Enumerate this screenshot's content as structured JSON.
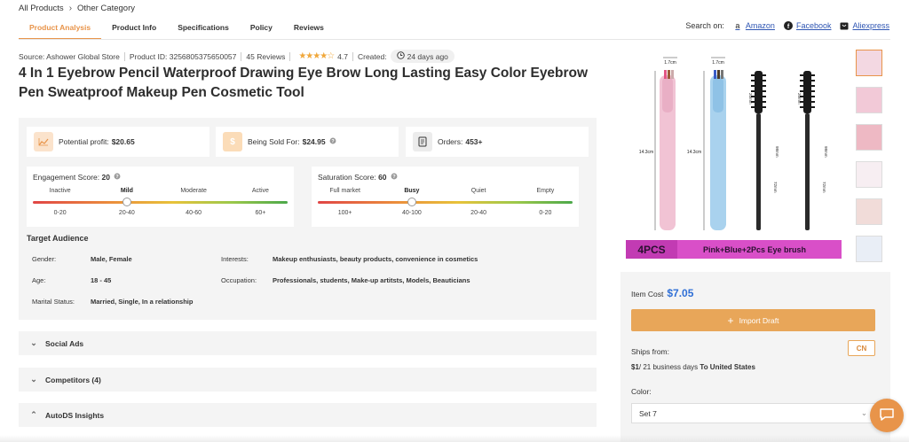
{
  "breadcrumb": {
    "items": [
      "All Products",
      "Other Category"
    ]
  },
  "tabs": [
    {
      "label": "Product Analysis",
      "active": true
    },
    {
      "label": "Product Info"
    },
    {
      "label": "Specifications"
    },
    {
      "label": "Policy"
    },
    {
      "label": "Reviews"
    }
  ],
  "search_on": {
    "label": "Search on:",
    "links": [
      {
        "label": "Amazon",
        "icon": "amazon-icon"
      },
      {
        "label": "Facebook",
        "icon": "facebook-icon"
      },
      {
        "label": "Aliexpress",
        "icon": "aliexpress-icon"
      }
    ]
  },
  "meta": {
    "source": "Source: Ashower Global Store",
    "product_id": "Product ID: 3256805375650057",
    "reviews": "45 Reviews",
    "stars": "★★★★☆",
    "rating": "4.7",
    "created_label": "Created:",
    "created_ago": "24 days ago"
  },
  "product": {
    "title": "4 In 1 Eyebrow Pencil Waterproof Drawing Eye Brow Long Lasting Easy Color Eyebrow Pen Sweatproof Makeup Pen Cosmetic Tool"
  },
  "stats": [
    {
      "label": "Potential profit:",
      "value": "$20.65",
      "icon": "chart-icon"
    },
    {
      "label": "Being Sold For:",
      "value": "$24.95",
      "icon": "dollar-icon"
    },
    {
      "label": "Orders:",
      "value": "453+",
      "icon": "orders-icon"
    }
  ],
  "engagement": {
    "label": "Engagement Score:",
    "value": "20",
    "level": 0.37,
    "levels": [
      "Inactive",
      "Mild",
      "Moderate",
      "Active"
    ],
    "ranges": [
      "0-20",
      "20-40",
      "40-60",
      "60+"
    ],
    "active_index": 1
  },
  "saturation": {
    "label": "Saturation Score:",
    "value": "60",
    "level": 0.37,
    "levels": [
      "Full market",
      "Busy",
      "Quiet",
      "Empty"
    ],
    "ranges": [
      "100+",
      "40-100",
      "20-40",
      "0-20"
    ],
    "active_index": 1
  },
  "target_audience": {
    "title": "Target Audience",
    "gender_label": "Gender:",
    "gender": "Male, Female",
    "age_label": "Age:",
    "age": "18 - 45",
    "marital_label": "Marital Status:",
    "marital": "Married, Single, In a relationship",
    "interests_label": "Interests:",
    "interests": "Makeup enthusiasts, beauty products, convenience in cosmetics",
    "occupation_label": "Occupation:",
    "occupation": "Professionals, students, Make-up artitsts, Models, Beauticians"
  },
  "accordions": [
    {
      "label": "Social Ads",
      "expanded": false
    },
    {
      "label": "Competitors (4)",
      "expanded": false
    },
    {
      "label": "AutoDS Insights",
      "expanded": true
    }
  ],
  "image_labels": {
    "dim1": "1.7cm",
    "dim2": "1.7cm",
    "len1": "14.3cm",
    "len2": "14.3cm",
    "brush1": "20mm",
    "brush1b": "98mm",
    "brush1c": "72mm",
    "brush2": "20mm",
    "brush2b": "98mm",
    "brush2c": "72mm",
    "banner_left": "4PCS",
    "banner_right": "Pink+Blue+2Pcs Eye brush"
  },
  "purchase": {
    "item_cost_label": "Item Cost",
    "item_cost": "$7.05",
    "import_label": "Import Draft",
    "ships_from_label": "Ships from:",
    "ships_from": "CN",
    "shipping_price": "$1",
    "shipping_days": "/ 21 business days",
    "shipping_to": "To United States",
    "color_label": "Color:",
    "color_value": "Set 7"
  },
  "colors": {
    "accent": "#e8944a",
    "link": "#2f56b3",
    "price": "#2f6fd6",
    "panel": "#f4f4f4"
  }
}
